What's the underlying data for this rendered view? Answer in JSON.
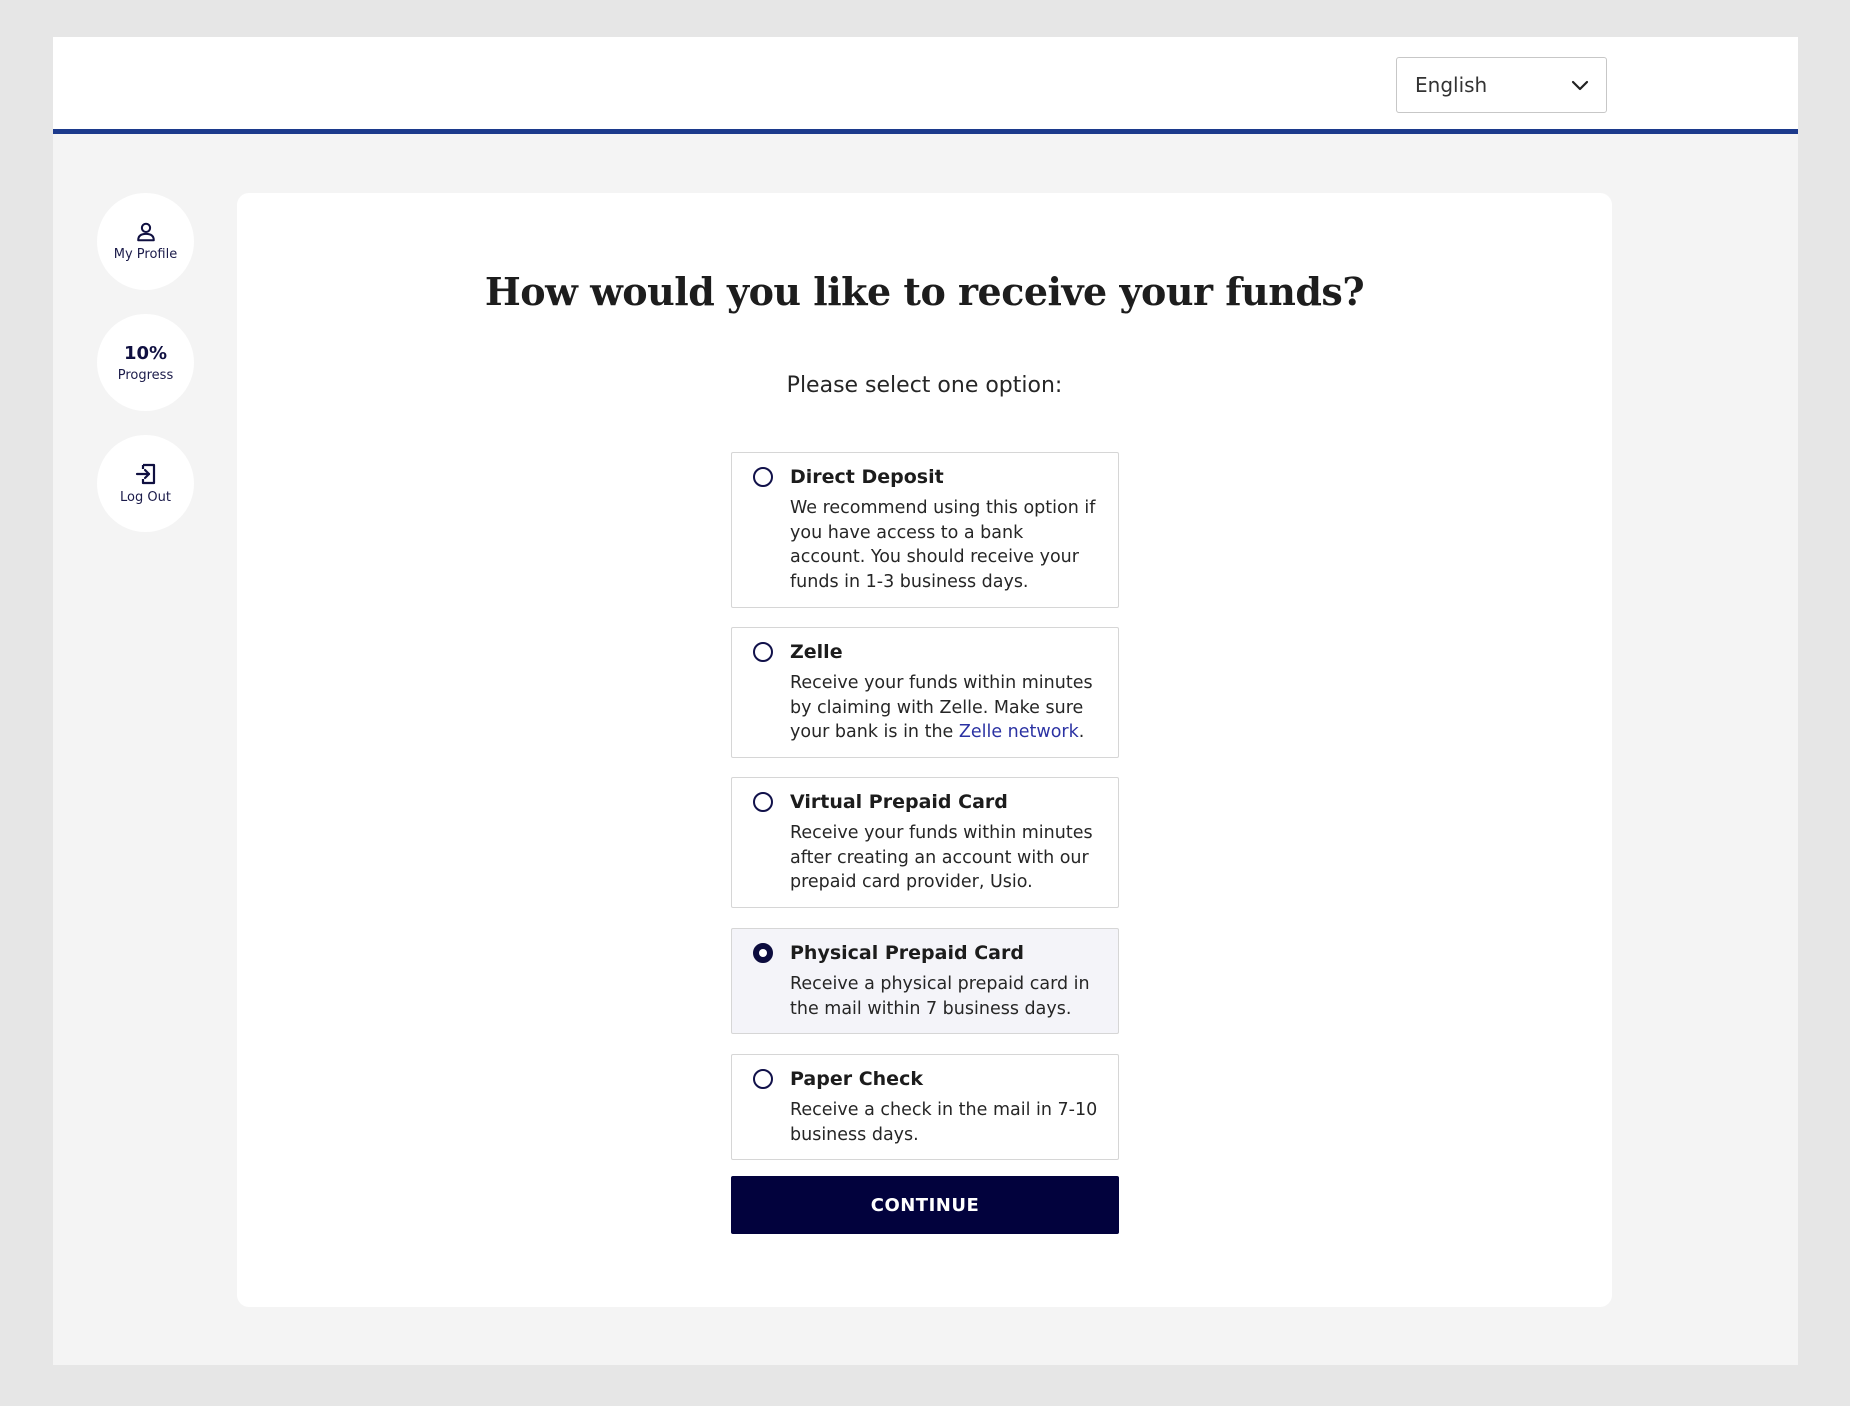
{
  "header": {
    "language_select": {
      "value": "English"
    }
  },
  "sidebar": {
    "profile_label": "My Profile",
    "progress_value": "10%",
    "progress_label": "Progress",
    "logout_label": "Log Out"
  },
  "main": {
    "title": "How would you like to receive your funds?",
    "instruction": "Please select one option:",
    "options": [
      {
        "title": "Direct Deposit",
        "description": "We recommend using this option if you have access to a bank account. You should receive your funds in 1-3 business days.",
        "selected": false
      },
      {
        "title": "Zelle",
        "description_before_link": "Receive your funds within minutes by claiming with Zelle. Make sure your bank is in the ",
        "link_text": "Zelle network",
        "description_after_link": ".",
        "selected": false
      },
      {
        "title": "Virtual Prepaid Card",
        "description": "Receive your funds within minutes after creating an account with our prepaid card provider, Usio.",
        "selected": false
      },
      {
        "title": "Physical Prepaid Card",
        "description": "Receive a physical prepaid card in the mail within 7 business days.",
        "selected": true
      },
      {
        "title": "Paper Check",
        "description": "Receive a check in the mail in 7-10 business days.",
        "selected": false
      }
    ],
    "continue_label": "CONTINUE"
  },
  "colors": {
    "accent_bar": "#1c3a8c",
    "button_bg": "#02023d",
    "link": "#2b32a3"
  },
  "icons": {
    "profile": "person-icon",
    "logout": "logout-icon",
    "language": "chevron-down-icon"
  }
}
